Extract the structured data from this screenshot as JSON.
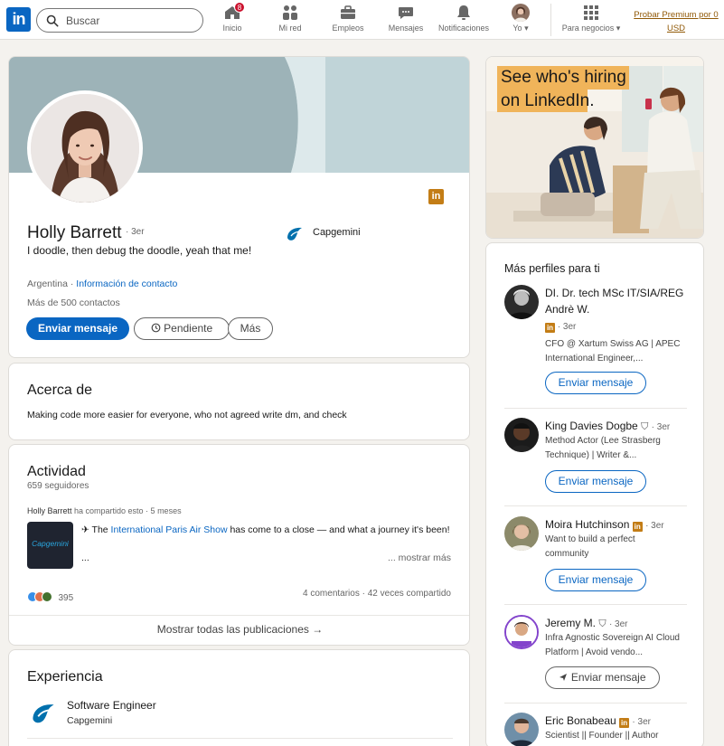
{
  "nav": {
    "logo": "in",
    "search_placeholder": "Buscar",
    "items": [
      {
        "label": "Inicio",
        "badge": "8"
      },
      {
        "label": "Mi red"
      },
      {
        "label": "Empleos"
      },
      {
        "label": "Mensajes"
      },
      {
        "label": "Notificaciones"
      },
      {
        "label": "Yo"
      },
      {
        "label": "Para negocios"
      }
    ],
    "premium": "Probar Premium por 0 USD"
  },
  "profile": {
    "name": "Holly Barrett",
    "degree": "· 3er",
    "headline": "I doodle, then debug the doodle, yeah that me!",
    "location": "Argentina",
    "dot": " · ",
    "contact_link": "Información de contacto",
    "connections": "Más de 500 contactos",
    "company": "Capgemini",
    "btn_message": "Enviar mensaje",
    "btn_pending": "Pendiente",
    "btn_more": "Más"
  },
  "about": {
    "title": "Acerca de",
    "text": "Making code more easier for everyone, who not agreed write dm, and check"
  },
  "activity": {
    "title": "Actividad",
    "followers": "659 seguidores",
    "post_author": "Holly Barrett",
    "post_meta": " ha compartido esto · 5 meses",
    "post_prefix": "✈ The ",
    "post_link": "International Paris Air Show",
    "post_rest": " has come to a close — and what a journey it's been!",
    "post_ellipsis": "...",
    "see_more": "... mostrar más",
    "thumb_text": "Capgemini",
    "reactions": "395",
    "comments": "4 comentarios · 42 veces compartido",
    "show_all": "Mostrar todas las publicaciones →"
  },
  "experience": {
    "title": "Experiencia",
    "role": "Software Engineer",
    "company": "Capgemini"
  },
  "ad": {
    "line1": "See who's hiring",
    "line2": "on LinkedIn."
  },
  "people": {
    "title": "Más perfiles para ti",
    "list": [
      {
        "name": "DI. Dr. tech MSc IT/SIA/REG Andrè W.",
        "degree": "· 3er",
        "desc": "CFO @ Xartum Swiss AG | APEC International Engineer,...",
        "button": "Enviar mensaje"
      },
      {
        "name": "King Davies Dogbe",
        "degree": "· 3er",
        "desc": "Method Actor (Lee Strasberg Technique) | Writer &...",
        "button": "Enviar mensaje"
      },
      {
        "name": "Moira Hutchinson",
        "degree": "· 3er",
        "desc": "Want to build a perfect community",
        "button": "Enviar mensaje"
      },
      {
        "name": "Jeremy M.",
        "degree": "· 3er",
        "desc": "Infra Agnostic Sovereign AI Cloud Platform | Avoid vendo...",
        "button": "Enviar mensaje"
      },
      {
        "name": "Eric Bonabeau",
        "degree": "· 3er",
        "desc": "Scientist || Founder || Author",
        "button": ""
      }
    ]
  },
  "colors": {
    "brand": "#0a66c2",
    "premium": "#915907",
    "badge": "#cb112d"
  }
}
